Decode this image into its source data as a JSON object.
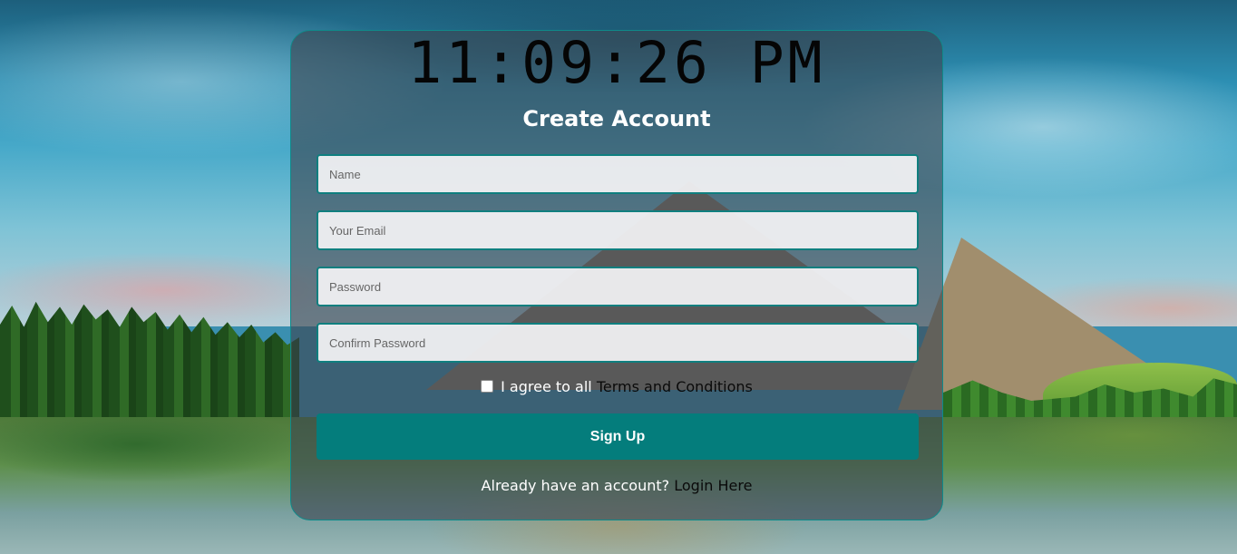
{
  "clock": {
    "time": "11:09:26 PM"
  },
  "form": {
    "title": "Create Account",
    "fields": {
      "name_placeholder": "Name",
      "email_placeholder": "Your Email",
      "password_placeholder": "Password",
      "confirm_placeholder": "Confirm Password"
    },
    "terms": {
      "prefix": "I agree to all",
      "link": "Terms and Conditions",
      "checked": false
    },
    "submit_label": "Sign Up",
    "login": {
      "prompt": "Already have an account?",
      "link": "Login Here"
    }
  },
  "colors": {
    "accent": "#047d7c",
    "border": "#0f7f7f",
    "card_overlay": "rgba(60,70,80,0.62)"
  }
}
